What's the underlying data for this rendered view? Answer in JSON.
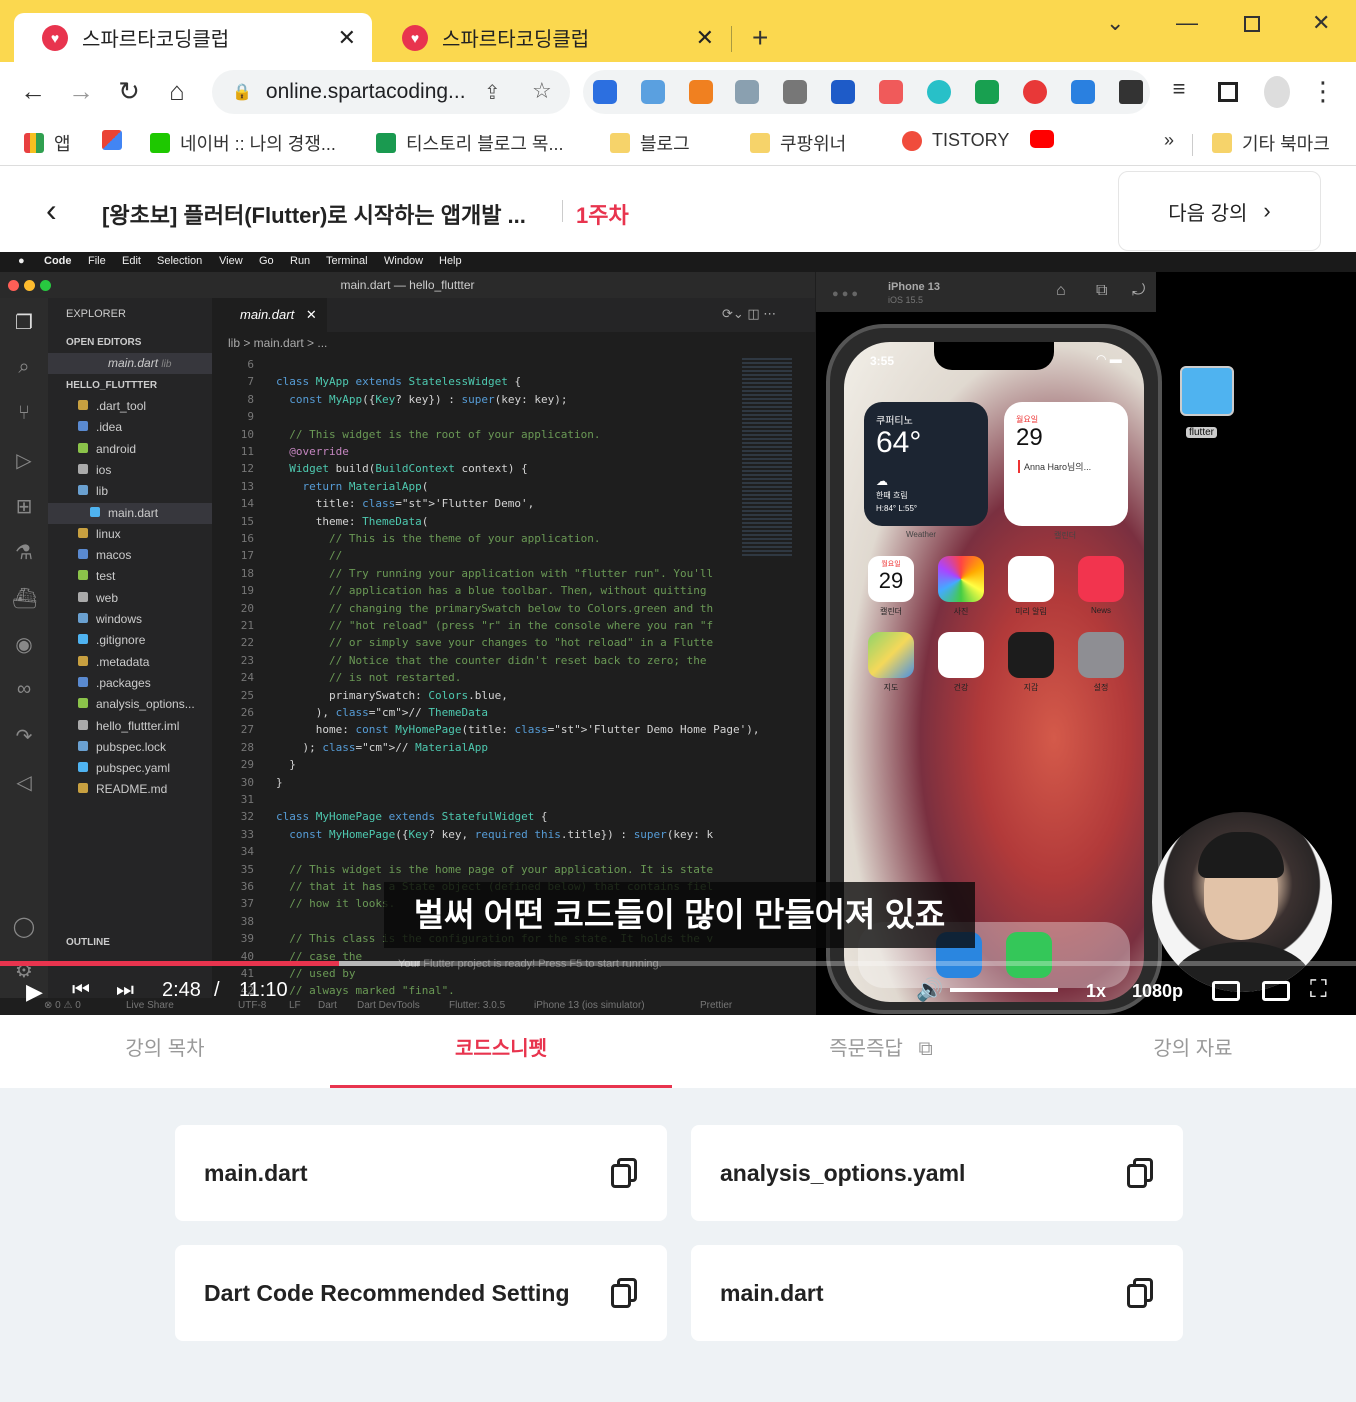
{
  "browser": {
    "tabs": [
      {
        "title": "스파르타코딩클럽"
      },
      {
        "title": "스파르타코딩클럽"
      }
    ],
    "new_tab": "+",
    "url": "online.spartacoding...",
    "bookmarks": [
      "앱",
      "네이버 :: 나의 경쟁...",
      "티스토리 블로그 목...",
      "블로그",
      "쿠팡위너",
      "TISTORY",
      "기타 북마크"
    ],
    "more_bookmarks": "»"
  },
  "header": {
    "course_title": "[왕초보] 플러터(Flutter)로 시작하는 앱개발 ...",
    "week": "1주차",
    "next_label": "다음 강의"
  },
  "video": {
    "mac_menu": [
      "Code",
      "File",
      "Edit",
      "Selection",
      "View",
      "Go",
      "Run",
      "Terminal",
      "Window",
      "Help"
    ],
    "window_title": "main.dart — hello_fluttter",
    "explorer": {
      "title": "EXPLORER",
      "open_editors": "OPEN EDITORS",
      "open_file": "main.dart",
      "open_file_dir": "lib",
      "project": "HELLO_FLUTTTER",
      "items": [
        ".dart_tool",
        ".idea",
        "android",
        "ios",
        "lib",
        "main.dart",
        "linux",
        "macos",
        "test",
        "web",
        "windows",
        ".gitignore",
        ".metadata",
        ".packages",
        "analysis_options...",
        "hello_fluttter.iml",
        "pubspec.lock",
        "pubspec.yaml",
        "README.md"
      ],
      "outline": "OUTLINE"
    },
    "editor_tab": "main.dart",
    "breadcrumb": "lib  >  main.dart  >  ...",
    "code": [
      {
        "n": "6",
        "t": ""
      },
      {
        "n": "7",
        "t": "class MyApp extends StatelessWidget {"
      },
      {
        "n": "8",
        "t": "  const MyApp({Key? key}) : super(key: key);"
      },
      {
        "n": "9",
        "t": ""
      },
      {
        "n": "10",
        "t": "  // This widget is the root of your application."
      },
      {
        "n": "11",
        "t": "  @override"
      },
      {
        "n": "12",
        "t": "  Widget build(BuildContext context) {"
      },
      {
        "n": "13",
        "t": "    return MaterialApp("
      },
      {
        "n": "14",
        "t": "      title: 'Flutter Demo',"
      },
      {
        "n": "15",
        "t": "      theme: ThemeData("
      },
      {
        "n": "16",
        "t": "        // This is the theme of your application."
      },
      {
        "n": "17",
        "t": "        //"
      },
      {
        "n": "18",
        "t": "        // Try running your application with \"flutter run\". You'll"
      },
      {
        "n": "19",
        "t": "        // application has a blue toolbar. Then, without quitting"
      },
      {
        "n": "20",
        "t": "        // changing the primarySwatch below to Colors.green and th"
      },
      {
        "n": "21",
        "t": "        // \"hot reload\" (press \"r\" in the console where you ran \"f"
      },
      {
        "n": "22",
        "t": "        // or simply save your changes to \"hot reload\" in a Flutte"
      },
      {
        "n": "23",
        "t": "        // Notice that the counter didn't reset back to zero; the"
      },
      {
        "n": "24",
        "t": "        // is not restarted."
      },
      {
        "n": "25",
        "t": "        primarySwatch: Colors.blue,"
      },
      {
        "n": "26",
        "t": "      ), // ThemeData"
      },
      {
        "n": "27",
        "t": "      home: const MyHomePage(title: 'Flutter Demo Home Page'),"
      },
      {
        "n": "28",
        "t": "    ); // MaterialApp"
      },
      {
        "n": "29",
        "t": "  }"
      },
      {
        "n": "30",
        "t": "}"
      },
      {
        "n": "31",
        "t": ""
      },
      {
        "n": "32",
        "t": "class MyHomePage extends StatefulWidget {"
      },
      {
        "n": "33",
        "t": "  const MyHomePage({Key? key, required this.title}) : super(key: k"
      },
      {
        "n": "34",
        "t": ""
      },
      {
        "n": "35",
        "t": "  // This widget is the home page of your application. It is state"
      },
      {
        "n": "36",
        "t": "  // that it has a State object (defined below) that contains fiel"
      },
      {
        "n": "37",
        "t": "  // how it looks."
      },
      {
        "n": "38",
        "t": ""
      },
      {
        "n": "39",
        "t": "  // This class is the configuration for the state. It holds the v"
      },
      {
        "n": "40",
        "t": "  // case the"
      },
      {
        "n": "41",
        "t": "  // used by"
      },
      {
        "n": "42",
        "t": "  // always marked \"final\"."
      }
    ],
    "status": {
      "errors": "⊗ 0 ⚠ 0",
      "live_share": "Live Share",
      "encoding": "UTF-8",
      "eol": "LF",
      "lang": "Dart",
      "devtools": "Dart DevTools",
      "flutter": "Flutter: 3.0.5",
      "device": "iPhone 13 (ios simulator)",
      "prettier": "Prettier",
      "notice": "Your Flutter project is ready! Press F5 to start running."
    },
    "simulator": {
      "device": "iPhone 13",
      "os": "iOS 15.5",
      "time": "3:55",
      "weather_city": "쿠퍼티노",
      "temp": "64°",
      "weather_desc": "한때 흐림",
      "hilo": "H:84° L:55°",
      "weather_label": "Weather",
      "cal_day": "월요일",
      "cal_date": "29",
      "cal_event": "Anna Haro님의...",
      "cal_label": "캘린더",
      "apps_row1": [
        {
          "label": "캘린더",
          "top": "월요일",
          "num": "29"
        },
        {
          "label": "사진"
        },
        {
          "label": "미리 알림"
        },
        {
          "label": "News"
        }
      ],
      "apps_row2": [
        {
          "label": "지도"
        },
        {
          "label": "건강"
        },
        {
          "label": "지갑"
        },
        {
          "label": "설정"
        }
      ],
      "folder_label": "flutter"
    },
    "subtitle": "벌써 어떤 코드들이 많이 만들어져 있죠",
    "current_time": "2:48",
    "separator": "/",
    "duration": "11:10",
    "progress": 0.25,
    "buffered": 0.31,
    "volume": 1.0,
    "speed": "1x",
    "quality": "1080p"
  },
  "lecture_tabs": [
    {
      "label": "강의 목차",
      "selected": false
    },
    {
      "label": "코드스니펫",
      "selected": true
    },
    {
      "label": "즉문즉답",
      "selected": false
    },
    {
      "label": "강의 자료",
      "selected": false
    }
  ],
  "snippets": [
    {
      "name": "main.dart"
    },
    {
      "name": "analysis_options.yaml"
    },
    {
      "name": "Dart Code Recommended Setting"
    },
    {
      "name": "main.dart"
    }
  ],
  "colors": {
    "brand": "#e8344e",
    "tabstrip": "#fbd84f"
  }
}
